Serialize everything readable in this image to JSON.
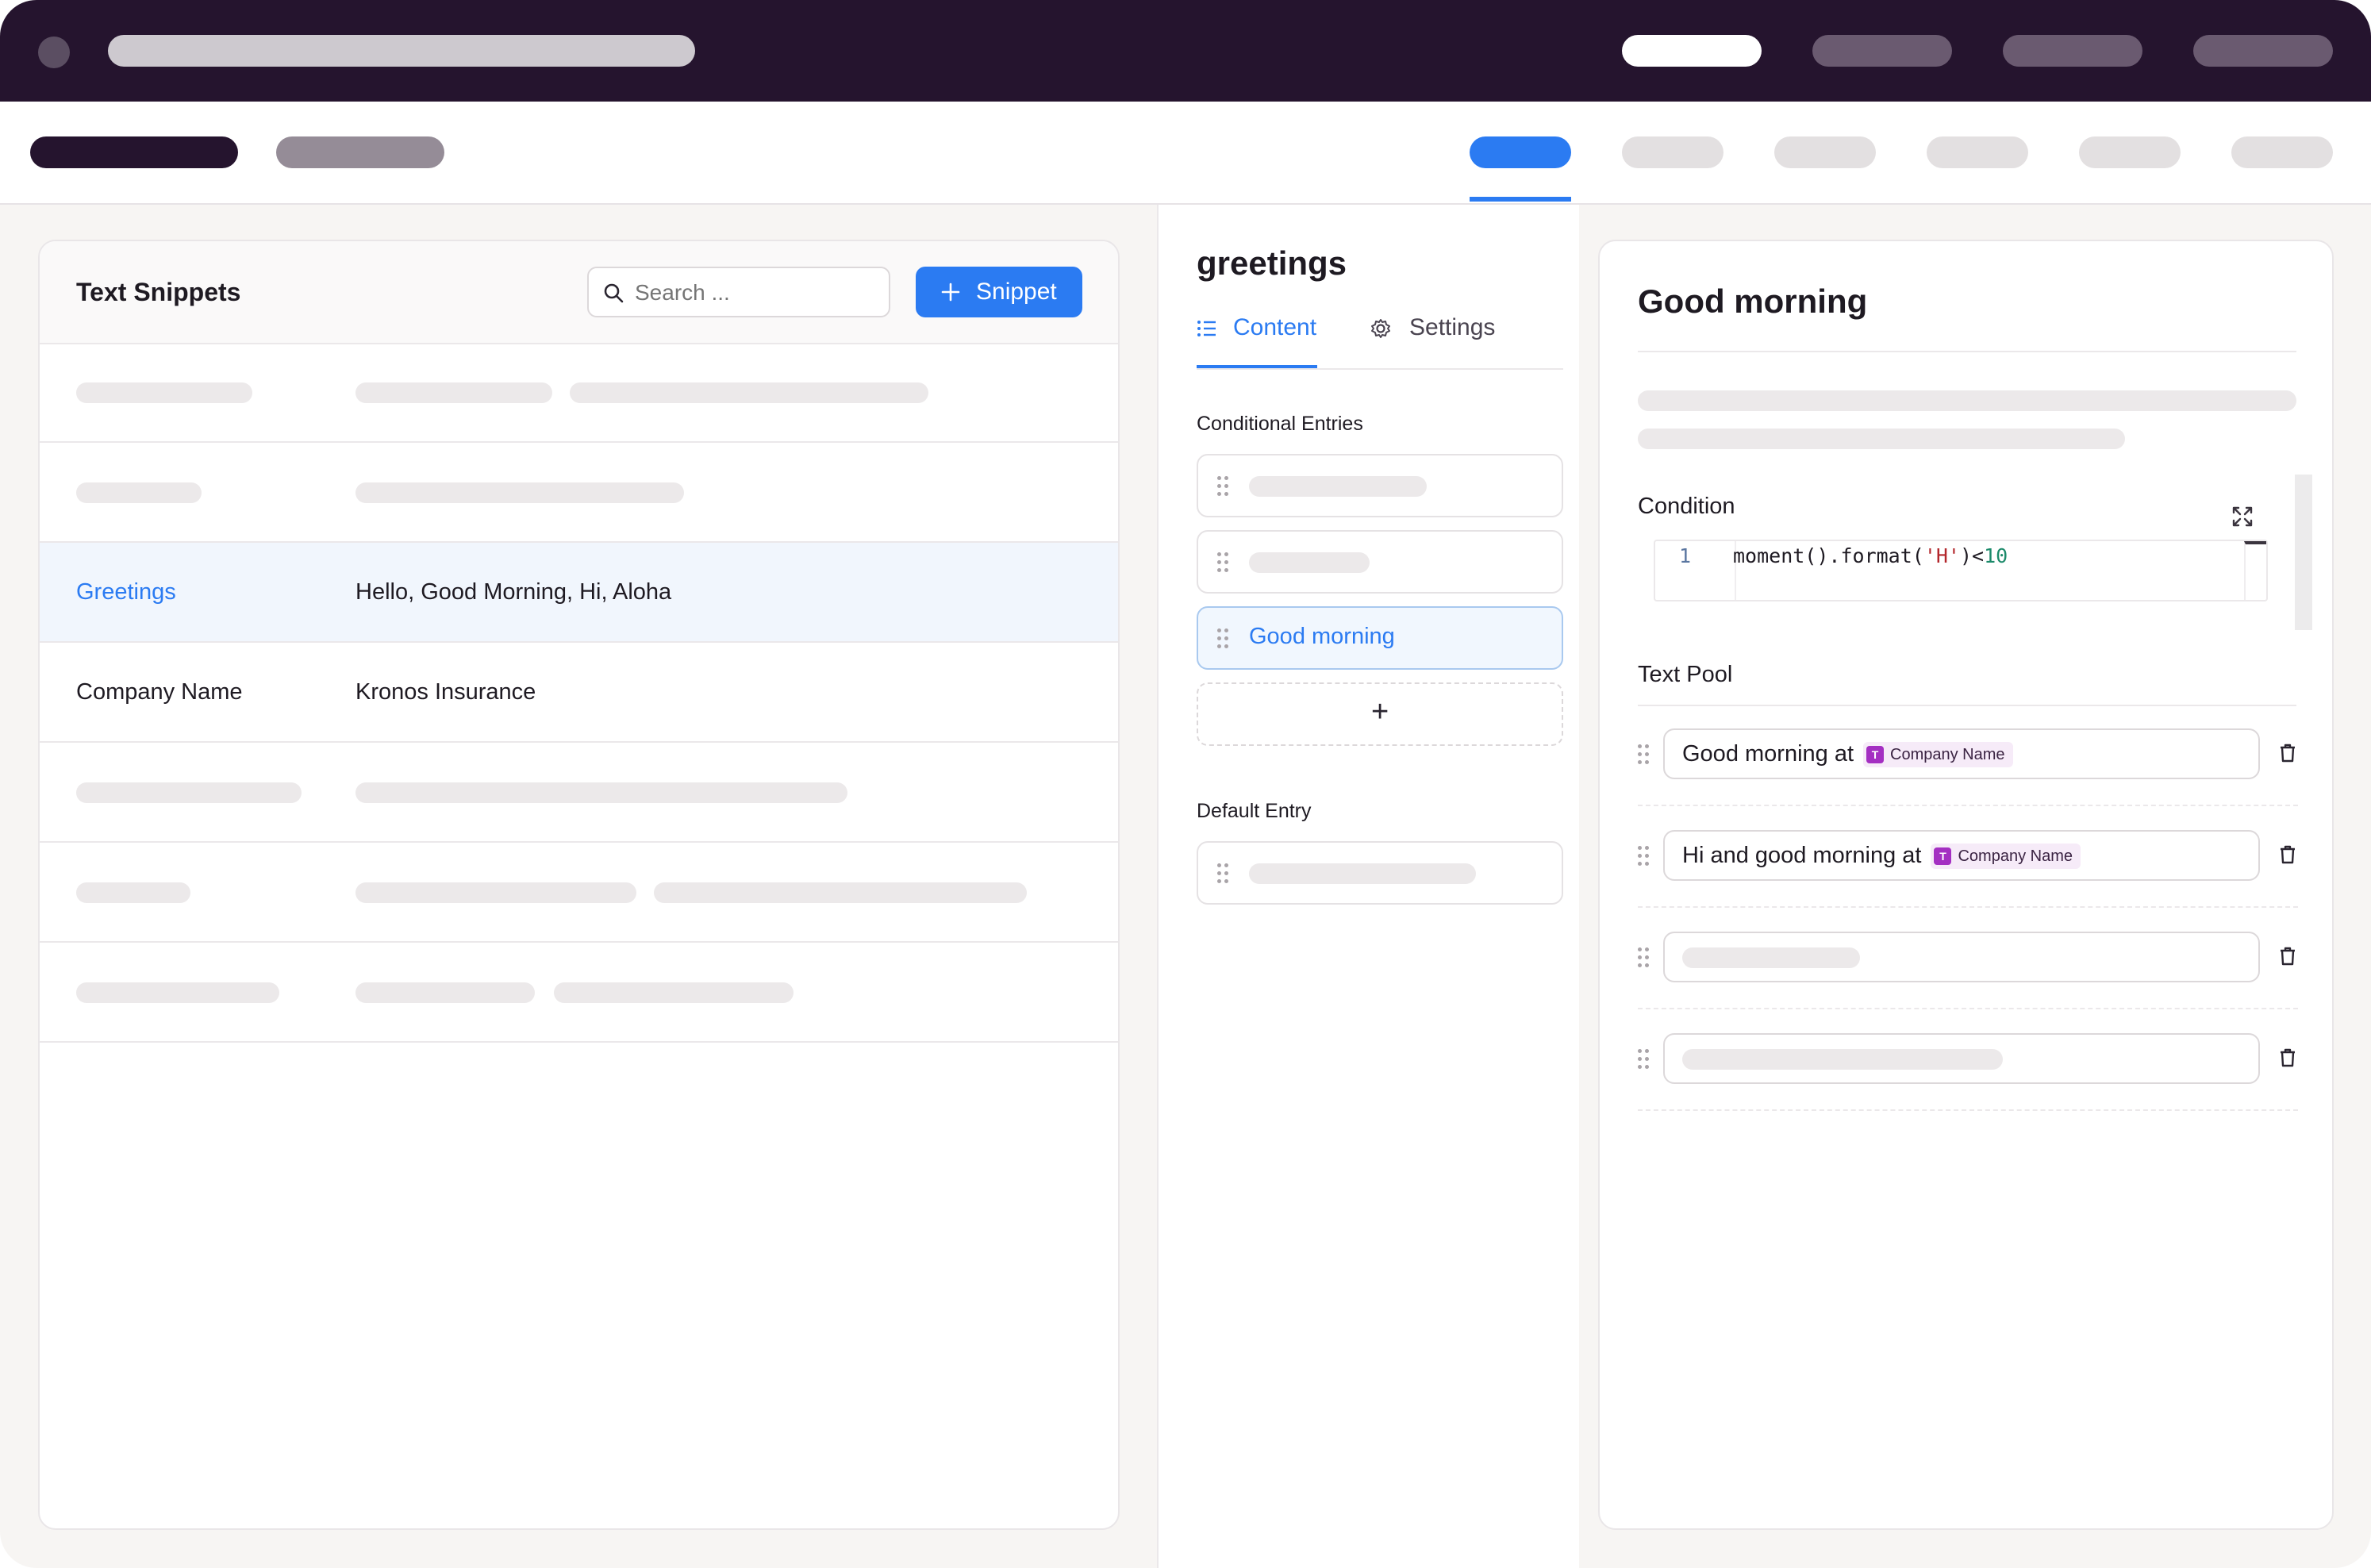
{
  "left_panel": {
    "title": "Text Snippets",
    "search_placeholder": "Search ...",
    "add_button_label": "Snippet",
    "rows": [
      {
        "name": "Greetings",
        "values": "Hello, Good Morning, Hi, Aloha",
        "selected": true
      },
      {
        "name": "Company Name",
        "values": "Kronos Insurance",
        "selected": false
      }
    ]
  },
  "middle_panel": {
    "title": "greetings",
    "tabs": [
      {
        "label": "Content",
        "icon": "list-icon",
        "active": true
      },
      {
        "label": "Settings",
        "icon": "gear-icon",
        "active": false
      }
    ],
    "conditional_entries_label": "Conditional Entries",
    "active_entry_label": "Good morning",
    "add_entry_symbol": "+",
    "default_entry_label": "Default Entry"
  },
  "right_panel": {
    "title": "Good morning",
    "condition_label": "Condition",
    "code": {
      "line_number": "1",
      "tokens": [
        "moment().format(",
        "'H'",
        ")<",
        "10"
      ]
    },
    "text_pool_label": "Text Pool",
    "pool_items": [
      {
        "text": "Good morning at",
        "tag_letter": "T",
        "tag_label": "Company Name"
      },
      {
        "text": "Hi and good morning at",
        "tag_letter": "T",
        "tag_label": "Company Name"
      }
    ]
  },
  "colors": {
    "accent": "#2b7bf2",
    "titlebar": "#25142e",
    "tag": "#a42fc2",
    "code_string": "#b3262b",
    "code_number": "#1c8a6a"
  }
}
